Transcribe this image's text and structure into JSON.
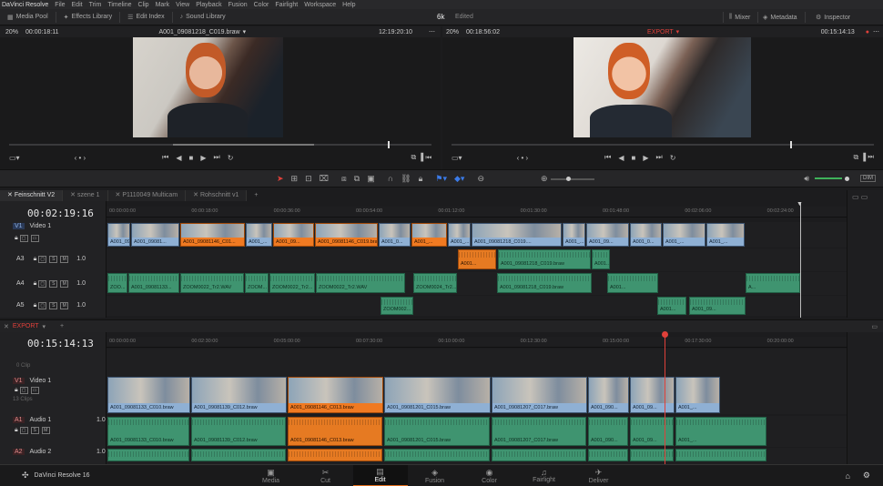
{
  "app": {
    "name": "DaVinci Resolve",
    "bottom_name": "DaVinci Resolve 16"
  },
  "menu": [
    "File",
    "Edit",
    "Trim",
    "Timeline",
    "Clip",
    "Mark",
    "View",
    "Playback",
    "Fusion",
    "Color",
    "Fairlight",
    "Workspace",
    "Help"
  ],
  "toolbar": {
    "media_pool": "Media Pool",
    "effects": "Effects Library",
    "edit_index": "Edit Index",
    "sound": "Sound Library",
    "project": "6k",
    "status": "Edited",
    "mixer": "Mixer",
    "metadata": "Metadata",
    "inspector": "Inspector"
  },
  "source_viewer": {
    "zoom": "20%",
    "timecode": "00:00:18:11",
    "clip": "A001_09081218_C019.braw",
    "tc_right": "12:19:20:10"
  },
  "program_viewer": {
    "zoom": "20%",
    "timecode": "00:18:56:02",
    "title": "EXPORT",
    "tc_right": "00:15:14:13"
  },
  "timeline_tabs": [
    "Feinschnitt V2",
    "szene 1",
    "P1110049 Multicam",
    "Rohschnitt v1"
  ],
  "upper": {
    "timecode": "00:02:19:16",
    "ruler": [
      "00:00:00:00",
      "00:00:18:00",
      "00:00:36:00",
      "00:00:54:00",
      "00:01:12:00",
      "00:01:30:00",
      "00:01:48:00",
      "00:02:06:00",
      "00:02:24:00"
    ],
    "tracks": [
      {
        "id": "V1",
        "name": "Video 1"
      },
      {
        "id": "A3",
        "name": ""
      },
      {
        "id": "A4",
        "name": ""
      },
      {
        "id": "A5",
        "name": ""
      }
    ],
    "video_clips": [
      "A001_09...",
      "A001_09081...",
      "A001_09081146_C01...",
      "A001_...",
      "A001_09...",
      "A001_09081146_C019.braw",
      "A001_0...",
      "A001_...",
      "A001_...",
      "A001_09081218_C019....",
      "A001_...",
      "A001_09...",
      "A001_0...",
      "A001_...",
      "A001_..."
    ],
    "a3_clips": [
      "A001...",
      "A001_09081218_C019.braw",
      "A001..."
    ],
    "a4_clips": [
      "ZOO...",
      "A001_09081133...",
      "ZOOM0022_Tr2.WAV",
      "ZOOM...",
      "ZOOM0022_Tr2...",
      "ZOOM0022_Tr2.WAV",
      "ZOOM0024_Tr2...",
      "A001_09081218_C019.braw",
      "A001...",
      "A..."
    ],
    "a5_clips": [
      "ZOOM002...",
      "A001...",
      "A001_09..."
    ]
  },
  "lower": {
    "title": "EXPORT",
    "timecode": "00:15:14:13",
    "ruler": [
      "00:00:00:00",
      "00:02:30:00",
      "00:05:00:00",
      "00:07:30:00",
      "00:10:00:00",
      "00:12:30:00",
      "00:15:00:00",
      "00:17:30:00",
      "00:20:00:00"
    ],
    "v1": {
      "id": "V1",
      "name": "Video 1",
      "count": "13 Clips",
      "clips_label": "0 Clip"
    },
    "a1": {
      "id": "A1",
      "name": "Audio 1",
      "level": "1.0"
    },
    "a2": {
      "id": "A2",
      "name": "Audio 2",
      "level": "1.0"
    },
    "video_clips": [
      "A001_09081133_C010.braw",
      "A001_09081139_C012.braw",
      "A001_09081146_C013.braw",
      "A001_09081201_C015.braw",
      "A001_09081207_C017.braw",
      "A001_090...",
      "A001_09...",
      "A001_..."
    ],
    "audio_clips": [
      "A001_09081133_C010.braw",
      "A001_09081139_C012.braw",
      "A001_09081146_C013.braw",
      "A001_09081201_C015.braw",
      "A001_09081207_C017.braw",
      "A001_090...",
      "A001_09...",
      "A001_..."
    ]
  },
  "pages": [
    {
      "icon": "▣",
      "label": "Media"
    },
    {
      "icon": "✂",
      "label": "Cut"
    },
    {
      "icon": "▤",
      "label": "Edit"
    },
    {
      "icon": "◈",
      "label": "Fusion"
    },
    {
      "icon": "◉",
      "label": "Color"
    },
    {
      "icon": "♫",
      "label": "Fairlight"
    },
    {
      "icon": "✈",
      "label": "Deliver"
    }
  ],
  "track_level": "1.0",
  "colors": {
    "accent": "#e06c1a",
    "video_clip": "#6e8fb4",
    "audio_clip": "#3f9470",
    "playhead": "#e0403a"
  }
}
